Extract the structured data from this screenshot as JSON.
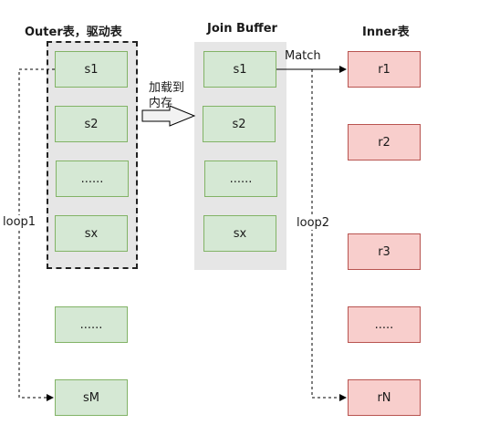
{
  "headings": {
    "outer": "Outer表，驱动表",
    "buffer": "Join Buffer",
    "inner": "Inner表"
  },
  "outer_nodes": [
    "s1",
    "s2",
    "......",
    "sx",
    "......",
    "sM"
  ],
  "buffer_nodes": [
    "s1",
    "s2",
    "......",
    "sx"
  ],
  "inner_nodes": [
    "r1",
    "r2",
    "r3",
    ".....",
    "rN"
  ],
  "labels": {
    "load_line1": "加载到",
    "load_line2": "内存",
    "match": "Match",
    "loop1": "loop1",
    "loop2": "loop2"
  },
  "colors": {
    "green_fill": "#d5e8d4",
    "green_stroke": "#82b366",
    "red_fill": "#f8cecc",
    "red_stroke": "#b85450",
    "panel_gray": "#e6e6e6"
  }
}
